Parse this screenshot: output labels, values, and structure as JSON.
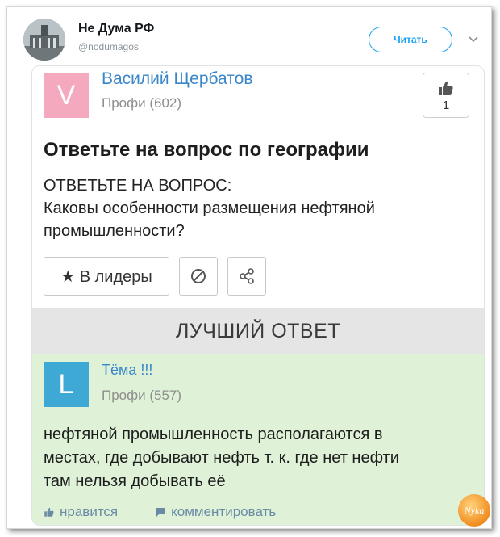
{
  "tweet": {
    "author_name": "Не Дума РФ",
    "author_handle": "@nodumagos",
    "follow_label": "Читать"
  },
  "post": {
    "author": {
      "initial": "V",
      "name": "Василий Щербатов",
      "rank": "Профи (602)",
      "avatar_color": "#f4a9bf"
    },
    "likes": "1",
    "title": "Ответьте на вопрос по географии",
    "body_lines": [
      "ОТВЕТЬТЕ НА ВОПРОС:",
      "Каковы особенности размещения нефтяной",
      "промышленности?"
    ],
    "leader_button": "★ В лидеры"
  },
  "best_answer": {
    "heading": "ЛУЧШИЙ ОТВЕТ",
    "author": {
      "initial": "L",
      "name": "Тёма !!!",
      "rank": "Профи (557)",
      "avatar_color": "#3fa9d6"
    },
    "text_lines": [
      "нефтяной промышленность располагаются в",
      "местах, где добывают нефть т. к. где нет нефти",
      "там нельзя добывать её"
    ],
    "like_label": "нравится",
    "comment_label": "комментировать"
  },
  "colors": {
    "link": "#3a86c8",
    "answer_bg": "#dff2d8",
    "follow": "#1da1f2"
  },
  "watermark": {
    "text": "Nyka"
  }
}
